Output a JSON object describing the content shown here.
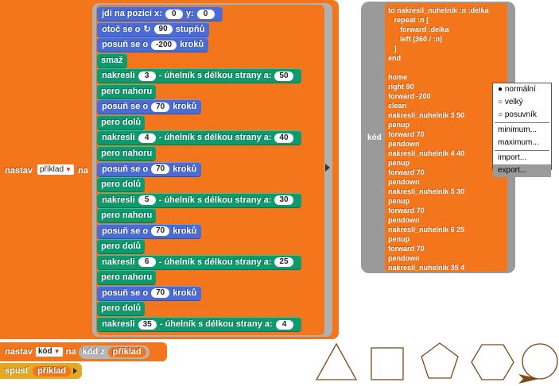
{
  "outer_block": {
    "set_label": "nastav",
    "var_name": "příklad",
    "to_label": "na"
  },
  "script": [
    {
      "kind": "motion",
      "parts": [
        "jdi na pozici x:",
        {
          "slot": "0"
        },
        "y:",
        {
          "slot": "0"
        }
      ]
    },
    {
      "kind": "motion",
      "parts": [
        "otoč se o",
        {
          "slot": "90",
          "icon": "turn-right-icon"
        },
        "stupňů"
      ]
    },
    {
      "kind": "motion",
      "parts": [
        "posuň se o",
        {
          "slot": "-200"
        },
        "kroků"
      ]
    },
    {
      "kind": "pen",
      "parts": [
        "smaž"
      ]
    },
    {
      "kind": "pen",
      "parts": [
        "nakresli",
        {
          "slot": "3"
        },
        "- úhelník s délkou strany a:",
        {
          "slot": "50"
        }
      ]
    },
    {
      "kind": "pen",
      "parts": [
        "pero nahoru"
      ]
    },
    {
      "kind": "motion",
      "parts": [
        "posuň se o",
        {
          "slot": "70"
        },
        "kroků"
      ]
    },
    {
      "kind": "pen",
      "parts": [
        "pero dolů"
      ]
    },
    {
      "kind": "pen",
      "parts": [
        "nakresli",
        {
          "slot": "4"
        },
        "- úhelník s délkou strany a:",
        {
          "slot": "40"
        }
      ]
    },
    {
      "kind": "pen",
      "parts": [
        "pero nahoru"
      ]
    },
    {
      "kind": "motion",
      "parts": [
        "posuň se o",
        {
          "slot": "70"
        },
        "kroků"
      ]
    },
    {
      "kind": "pen",
      "parts": [
        "pero dolů"
      ]
    },
    {
      "kind": "pen",
      "parts": [
        "nakresli",
        {
          "slot": "5"
        },
        "- úhelník s délkou strany a:",
        {
          "slot": "30"
        }
      ]
    },
    {
      "kind": "pen",
      "parts": [
        "pero nahoru"
      ]
    },
    {
      "kind": "motion",
      "parts": [
        "posuň se o",
        {
          "slot": "70"
        },
        "kroků"
      ]
    },
    {
      "kind": "pen",
      "parts": [
        "pero dolů"
      ]
    },
    {
      "kind": "pen",
      "parts": [
        "nakresli",
        {
          "slot": "6"
        },
        "- úhelník s délkou strany a:",
        {
          "slot": "25"
        }
      ]
    },
    {
      "kind": "pen",
      "parts": [
        "pero nahoru"
      ]
    },
    {
      "kind": "motion",
      "parts": [
        "posuň se o",
        {
          "slot": "70"
        },
        "kroků"
      ]
    },
    {
      "kind": "pen",
      "parts": [
        "pero dolů"
      ]
    },
    {
      "kind": "pen",
      "parts": [
        "nakresli",
        {
          "slot": "35"
        },
        "- úhelník s délkou strany a:",
        {
          "slot": "4"
        }
      ]
    }
  ],
  "set_code_block": {
    "set_label": "nastav",
    "var_name": "kód",
    "to_label": "na",
    "code_of": "kód z",
    "code_var": "příklad"
  },
  "run_block": {
    "label": "spusť",
    "var_name": "příklad"
  },
  "code_panel": {
    "label": "kód",
    "text": "to nakresli_nuhelnik :n :delka\n   repeat :n [\n      forward :delka\n      left (360 / :n)\n   ]\nend\n\nhome\nright 90\nforward -200\nclean\nnakresli_nuhelnik 3 50\npenup\nforward 70\npendown\nnakresli_nuhelnik 4 40\npenup\nforward 70\npendown\nnakresli_nuhelnik 5 30\npenup\nforward 70\npendown\nnakresli_nuhelnik 6 25\npenup\nforward 70\npendown\nnakresli_nuhelnik 35 4"
  },
  "context_menu": {
    "items": [
      "normální",
      "velký",
      "posuvník",
      "minimum...",
      "maximum...",
      "import...",
      "export..."
    ],
    "selected": "normální",
    "highlighted": "export..."
  },
  "colors": {
    "motion": "#4a6cd4",
    "pen": "#0e9a6c",
    "variables": "#f3761d",
    "control": "#e6a822",
    "shape_stroke": "#7a4a1a"
  }
}
